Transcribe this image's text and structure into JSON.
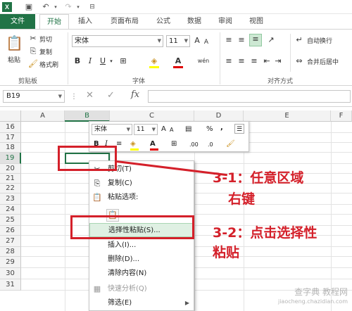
{
  "quick_access": {
    "app_icon": "X"
  },
  "tabs": [
    {
      "label": "文件"
    },
    {
      "label": "开始"
    },
    {
      "label": "插入"
    },
    {
      "label": "页面布局"
    },
    {
      "label": "公式"
    },
    {
      "label": "数据"
    },
    {
      "label": "审阅"
    },
    {
      "label": "视图"
    }
  ],
  "ribbon": {
    "clipboard": {
      "paste": "粘贴",
      "cut": "剪切",
      "copy": "复制",
      "format_painter": "格式刷",
      "group": "剪贴板"
    },
    "font": {
      "name": "宋体",
      "size": "11",
      "group": "字体",
      "grow": "A",
      "shrink": "A",
      "bold": "B",
      "italic": "I",
      "underline": "U",
      "font_color": "A",
      "wen": "wén"
    },
    "align": {
      "wrap": "自动换行",
      "merge": "合并后居中",
      "group": "对齐方式"
    }
  },
  "formula_bar": {
    "name_box": "B19",
    "cancel": "✕",
    "enter": "✓",
    "fx": "fx",
    "value": ""
  },
  "columns": [
    "A",
    "B",
    "C",
    "D",
    "E",
    "F"
  ],
  "rows": [
    "16",
    "17",
    "18",
    "19",
    "20",
    "21",
    "22",
    "23",
    "24",
    "25",
    "26",
    "27",
    "28",
    "29",
    "30",
    "31"
  ],
  "mini_toolbar": {
    "font_name": "宋体",
    "font_size": "11",
    "grow": "A",
    "shrink": "A",
    "percent": "%",
    "comma": ",",
    "bold": "B",
    "italic": "I",
    "font_color": "A",
    "inc_dec": ".00",
    "dec_dec": ".0"
  },
  "context_menu": [
    {
      "label": "剪切(T)",
      "icon": "scissors-icon",
      "glyph": "✂"
    },
    {
      "label": "复制(C)",
      "icon": "copy-icon",
      "glyph": "⎘"
    },
    {
      "label": "粘贴选项:",
      "icon": "paste-icon",
      "glyph": "📋"
    },
    {
      "label": "",
      "icon": "",
      "glyph": ""
    },
    {
      "label": "选择性粘贴(S)...",
      "icon": "",
      "glyph": ""
    },
    {
      "label": "插入(I)...",
      "icon": "",
      "glyph": ""
    },
    {
      "label": "删除(D)...",
      "icon": "",
      "glyph": ""
    },
    {
      "label": "清除内容(N)",
      "icon": "",
      "glyph": ""
    },
    {
      "label": "快速分析(Q)",
      "icon": "quick-analysis-icon",
      "glyph": "▦"
    },
    {
      "label": "筛选(E)",
      "icon": "",
      "glyph": ""
    }
  ],
  "annotations": {
    "step1_line1": "3-1：任意区域",
    "step1_line2": "右键",
    "step2_line1": "3-2：点击选择性",
    "step2_line2": "粘贴"
  },
  "watermark": {
    "line1": "查字典 教程网",
    "line2": "jiaocheng.chazidian.com"
  },
  "colors": {
    "excel_green": "#217346",
    "annotation_red": "#d4202a",
    "highlight": "#dff0e3"
  }
}
